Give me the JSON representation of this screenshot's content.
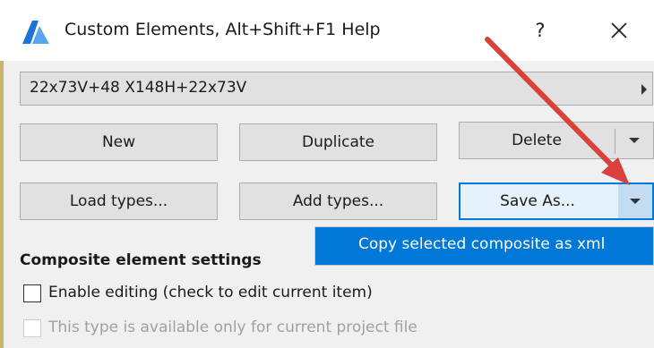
{
  "window": {
    "title": "Custom Elements, Alt+Shift+F1 Help",
    "help_label": "?",
    "icon": "app-logo-icon",
    "close_icon": "close-icon"
  },
  "selector": {
    "value": "22x73V+48 X148H+22x73V",
    "arrow_icon": "chevron-right-icon"
  },
  "buttons": {
    "new": "New",
    "duplicate": "Duplicate",
    "delete": "Delete",
    "load_types": "Load types...",
    "add_types": "Add types...",
    "save_as": "Save As..."
  },
  "menu": {
    "items": [
      "Copy selected composite as xml"
    ]
  },
  "settings": {
    "section_title": "Composite element settings",
    "enable_editing": "Enable editing (check to edit current item)",
    "project_only": "This type is available only for current project file"
  },
  "colors": {
    "accent": "#0078d7",
    "annotation_arrow": "#e0443e",
    "button_face": "#e1e1e1"
  }
}
